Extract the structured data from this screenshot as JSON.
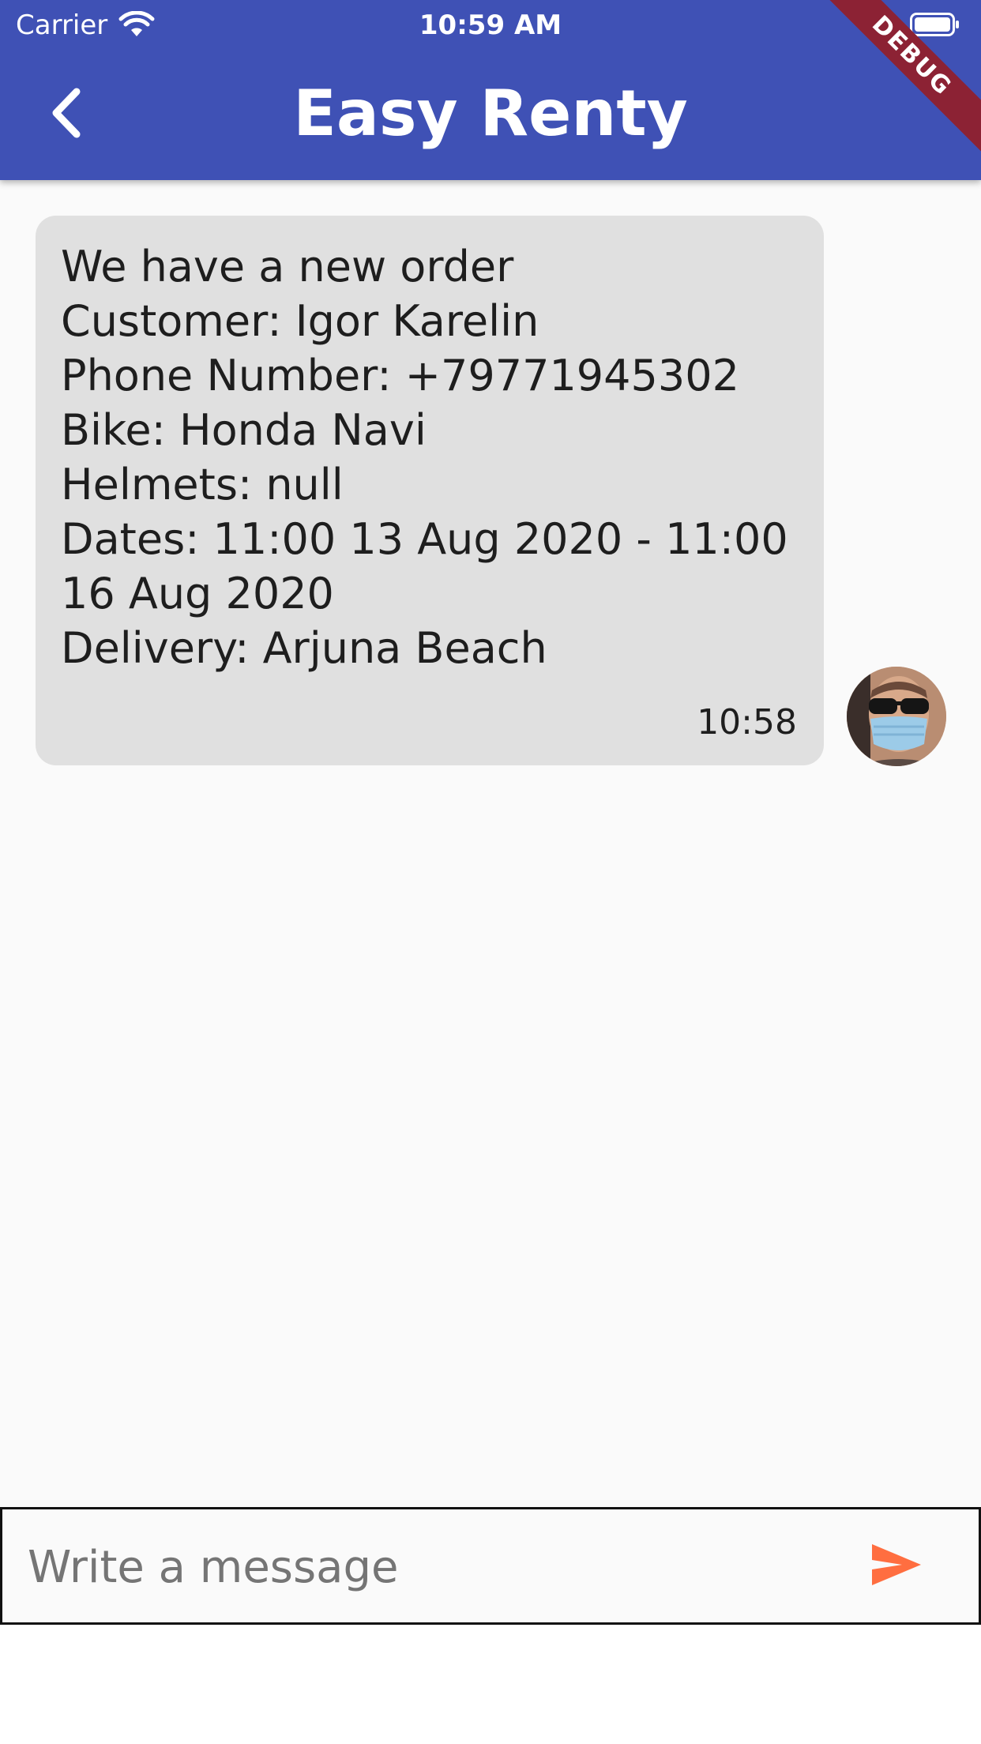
{
  "status_bar": {
    "carrier": "Carrier",
    "time": "10:59 AM"
  },
  "app_bar": {
    "title": "Easy Renty",
    "debug_label": "DEBUG",
    "color": "#3f51b5"
  },
  "messages": [
    {
      "lines": [
        "We have a new order",
        "Customer: Igor Karelin",
        "Phone Number: +79771945302",
        "Bike: Honda Navi",
        "Helmets: null",
        "Dates: 11:00 13 Aug 2020 - 11:00",
        "16 Aug 2020",
        "Delivery: Arjuna Beach"
      ],
      "time": "10:58",
      "bubble_color": "#e0e0e0"
    }
  ],
  "composer": {
    "placeholder": "Write a message",
    "send_icon_color": "#ff6e40"
  },
  "icons": {
    "back": "back-arrow-icon",
    "send": "send-icon",
    "wifi": "wifi-icon",
    "battery": "battery-icon"
  }
}
